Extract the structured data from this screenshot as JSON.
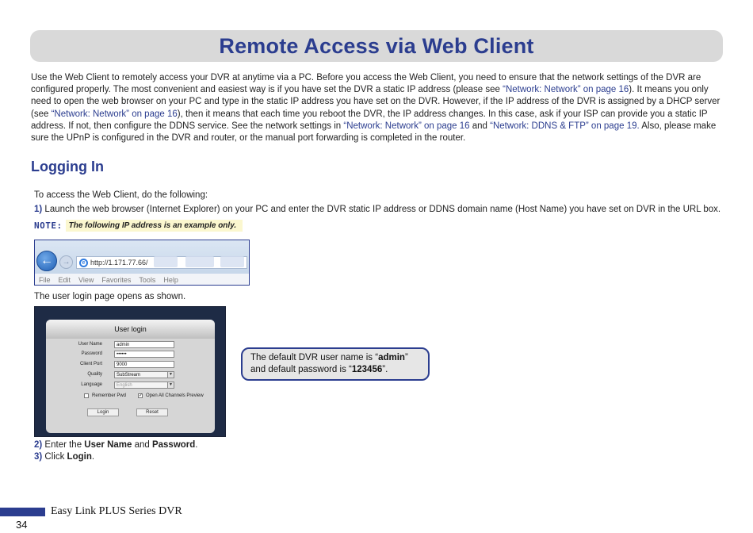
{
  "title": "Remote Access via Web Client",
  "intro": [
    {
      "t": "Use the Web Client to remotely access your DVR at anytime via a PC. Before you access the Web Client, you need to ensure that the network settings of the DVR are configured properly. The most convenient and easiest way is if you have set the DVR a static IP address (please "
    },
    {
      "t": "see "
    },
    {
      "t": "“Network: Network” on page 16",
      "link": true
    },
    {
      "t": "). It means you only need to open the web browser on your PC and type in the static IP address you have set on the DVR. However, if the IP address of the DVR is assigned by a DHCP server ("
    },
    {
      "t": "see "
    },
    {
      "t": "“Network: Network” on page 16",
      "link": true
    },
    {
      "t": "), then it means that each time you reboot the DVR, the IP address changes. In this case, ask if your ISP can provide you a static IP address. If not, then configure the DDNS service. See the network settings in "
    },
    {
      "t": "“Network: Network” on page 16",
      "link": true
    },
    {
      "t": " and "
    },
    {
      "t": "“Network: DDNS & FTP” on page 19.",
      "link": true
    },
    {
      "t": " Also, please make sure the UPnP is configured in the DVR and router, or the manual port forwarding is completed in the router."
    }
  ],
  "section_heading": "Logging In",
  "access_intro": "To access the Web Client, do the following:",
  "step1": {
    "num": "1)",
    "text": " Launch the web browser (Internet Explorer) on your PC and enter the DVR static IP address or DDNS domain name (Host Name) you have set on DVR in the URL box."
  },
  "note": {
    "label": "NOTE:",
    "text": "The following IP address is an example only."
  },
  "browser": {
    "back_glyph": "←",
    "forward_glyph": "→",
    "ie_glyph": "e",
    "url": "http://1.171.77.66/",
    "menu": [
      "File",
      "Edit",
      "View",
      "Favorites",
      "Tools",
      "Help"
    ]
  },
  "login_intro": "The user login page opens as shown.",
  "login": {
    "header": "User login",
    "rows": [
      {
        "label": "User Name",
        "value": "admin"
      },
      {
        "label": "Password",
        "value": "••••••"
      },
      {
        "label": "Client Port",
        "value": "9000"
      },
      {
        "label": "Quality",
        "value": "SubStream"
      },
      {
        "label": "Language",
        "value": "English"
      }
    ],
    "select_arrow": "▼",
    "remember_label": "Remember Pwd",
    "open_all_label": "Open All Channels Preview",
    "open_all_check": "✓",
    "login_btn": "Login",
    "reset_btn": "Reset"
  },
  "callout": {
    "p1": "The default DVR user name is “",
    "user": "admin",
    "p2": "” and default password is “",
    "pass": "123456",
    "p3": "”."
  },
  "step2": {
    "num": "2)",
    "a": " Enter the ",
    "b": "User Name",
    "c": " and ",
    "d": "Password",
    "e": "."
  },
  "step3": {
    "num": "3)",
    "a": " Click ",
    "b": "Login",
    "c": "."
  },
  "footer": {
    "brand": "Easy Link PLUS Series DVR",
    "page": "34"
  }
}
